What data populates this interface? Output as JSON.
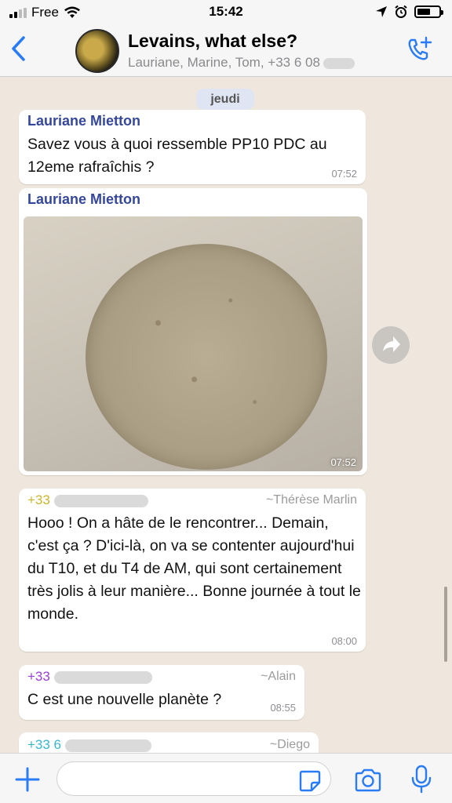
{
  "status_bar": {
    "carrier": "Free",
    "time": "15:42"
  },
  "header": {
    "title": "Levains, what else?",
    "subtitle": "Lauriane, Marine, Tom, +33 6 08"
  },
  "date_separator": "jeudi",
  "messages": [
    {
      "sender": "Lauriane Mietton",
      "text": "Savez vous à quoi ressemble PP10 PDC au 12eme rafraîchis ?",
      "time": "07:52"
    },
    {
      "sender": "Lauriane Mietton",
      "image_time": "07:52"
    },
    {
      "sender_phone": "+33",
      "alias": "~Thérèse Marlin",
      "text": "Hooo ! On a hâte de le rencontrer... Demain, c'est ça ? D'ici-là, on va se contenter aujourd'hui du T10, et du T4 de AM, qui sont certainement très jolis à leur manière... Bonne journée à tout le monde.",
      "time": "08:00"
    },
    {
      "sender_phone": "+33",
      "alias": "~Alain",
      "text": "C est une nouvelle planète ?",
      "time": "08:55"
    },
    {
      "sender_phone": "+33 6",
      "alias": "~Diego"
    }
  ],
  "colors": {
    "accent": "#2a7cf6",
    "sender_lauriane": "#35479a",
    "sender_therese": "#c9b52e",
    "sender_alain": "#9a3fd6",
    "sender_diego": "#39b7cf",
    "chat_bg": "#efe7dd"
  },
  "icons": [
    "back-icon",
    "add-call-icon",
    "plus-icon",
    "sticker-icon",
    "camera-icon",
    "microphone-icon",
    "share-icon",
    "wifi-icon",
    "location-icon",
    "alarm-icon"
  ]
}
